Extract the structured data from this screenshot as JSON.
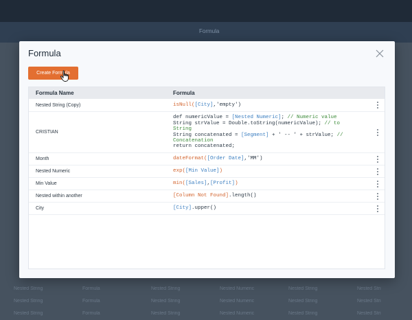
{
  "background": {
    "header_title": "Formula",
    "rows": [
      [
        "Nested String",
        "Formula",
        "Nested String",
        "Nested Numeric",
        "Nested String",
        "Nested Stri"
      ],
      [
        "Nested String",
        "Formula",
        "Nested String",
        "Nested Numeric",
        "Nested String",
        "Nested Stri"
      ],
      [
        "Nested String",
        "Formula",
        "Nested String",
        "Nested Numeric",
        "Nested String",
        "Nested Stri"
      ]
    ]
  },
  "modal": {
    "title": "Formula",
    "create_button_label": "Create Formula",
    "table": {
      "columns": [
        "Formula Name",
        "Formula"
      ],
      "rows": [
        {
          "name": "Nested String (Copy)",
          "formula": [
            [
              [
                "fn",
                "isNull("
              ],
              [
                "ref",
                "[City]"
              ],
              [
                "str",
                ",'empty')"
              ]
            ]
          ]
        },
        {
          "name": "CRISTIAN",
          "formula": [
            [
              [
                "str",
                "def numericValue = "
              ],
              [
                "ref",
                "[Nested Numeric]"
              ],
              [
                "str",
                "; "
              ],
              [
                "cmt",
                "// Numeric value"
              ]
            ],
            [
              [
                "str",
                "String strValue = Double.toString(numericValue); "
              ],
              [
                "cmt",
                "// to"
              ]
            ],
            [
              [
                "cmt",
                "String"
              ]
            ],
            [
              [
                "str",
                "String concatenated = "
              ],
              [
                "ref",
                "[Segment]"
              ],
              [
                "str",
                " + ' -- ' + strValue; "
              ],
              [
                "cmt",
                "//"
              ]
            ],
            [
              [
                "cmt",
                "Concatenation"
              ]
            ],
            [
              [
                "str",
                "return concatenated;"
              ]
            ]
          ]
        },
        {
          "name": "Month",
          "formula": [
            [
              [
                "fn",
                "dateFormat("
              ],
              [
                "ref",
                "[Order Date]"
              ],
              [
                "str",
                ",'MM')"
              ]
            ]
          ]
        },
        {
          "name": "Nested Numeric",
          "formula": [
            [
              [
                "fn",
                "exp("
              ],
              [
                "ref",
                "[Min Value]"
              ],
              [
                "fn",
                ")"
              ]
            ]
          ]
        },
        {
          "name": "Min Value",
          "formula": [
            [
              [
                "fn",
                "min("
              ],
              [
                "ref",
                "[Sales]"
              ],
              [
                "str",
                ","
              ],
              [
                "ref",
                "[Profit]"
              ],
              [
                "fn",
                ")"
              ]
            ]
          ]
        },
        {
          "name": "Nested within another",
          "formula": [
            [
              [
                "fn",
                "[Column Not Found]"
              ],
              [
                "str",
                ".length()"
              ]
            ]
          ]
        },
        {
          "name": "City",
          "formula": [
            [
              [
                "ref",
                "[City]"
              ],
              [
                "str",
                ".upper()"
              ]
            ]
          ]
        }
      ]
    }
  }
}
